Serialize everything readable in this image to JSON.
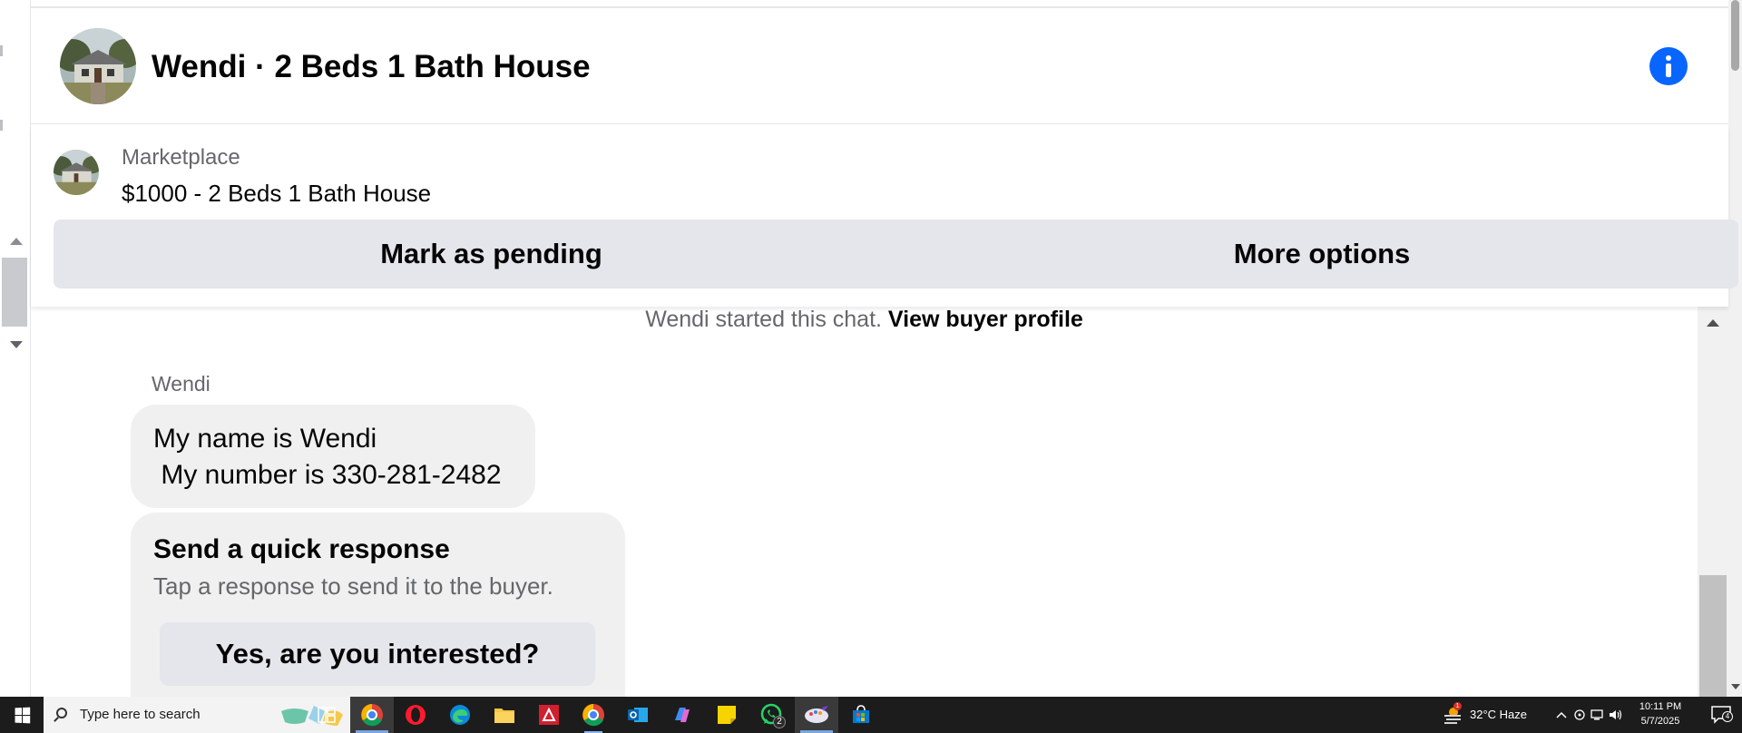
{
  "header": {
    "title": "Wendi · 2 Beds 1 Bath House",
    "info_icon": "info-icon"
  },
  "listing": {
    "category": "Marketplace",
    "title": "$1000 - 2 Beds 1 Bath House",
    "mark_pending_label": "Mark as pending",
    "more_options_label": "More options"
  },
  "chat": {
    "started_text": "Wendi started this chat. ",
    "view_profile_label": "View buyer profile",
    "sender_name": "Wendi",
    "message_line1": "My name is Wendi",
    "message_line2": " My number is 330-281-2482",
    "quick_response": {
      "title": "Send a quick response",
      "subtitle": "Tap a response to send it to the buyer.",
      "reply_label": "Yes, are you interested?"
    }
  },
  "taskbar": {
    "search_placeholder": "Type here to search",
    "apps": [
      "task-view-icon",
      "chrome-icon",
      "opera-icon",
      "edge-icon",
      "file-explorer-icon",
      "amd-icon",
      "chrome-icon",
      "outlook-icon",
      "copilot-icon",
      "sticky-notes-icon",
      "whatsapp-icon",
      "paint-icon",
      "store-icon"
    ],
    "whatsapp_badge": "2",
    "weather_alert": "1",
    "weather": "32°C  Haze",
    "time": "10:11 PM",
    "date": "5/7/2025",
    "notification_count": "4"
  },
  "colors": {
    "accent_blue": "#0866ff",
    "button_gray": "#e4e6eb",
    "bubble_gray": "#f0f0f0",
    "secondary_text": "#65676b",
    "taskbar": "#1c1c1c"
  }
}
